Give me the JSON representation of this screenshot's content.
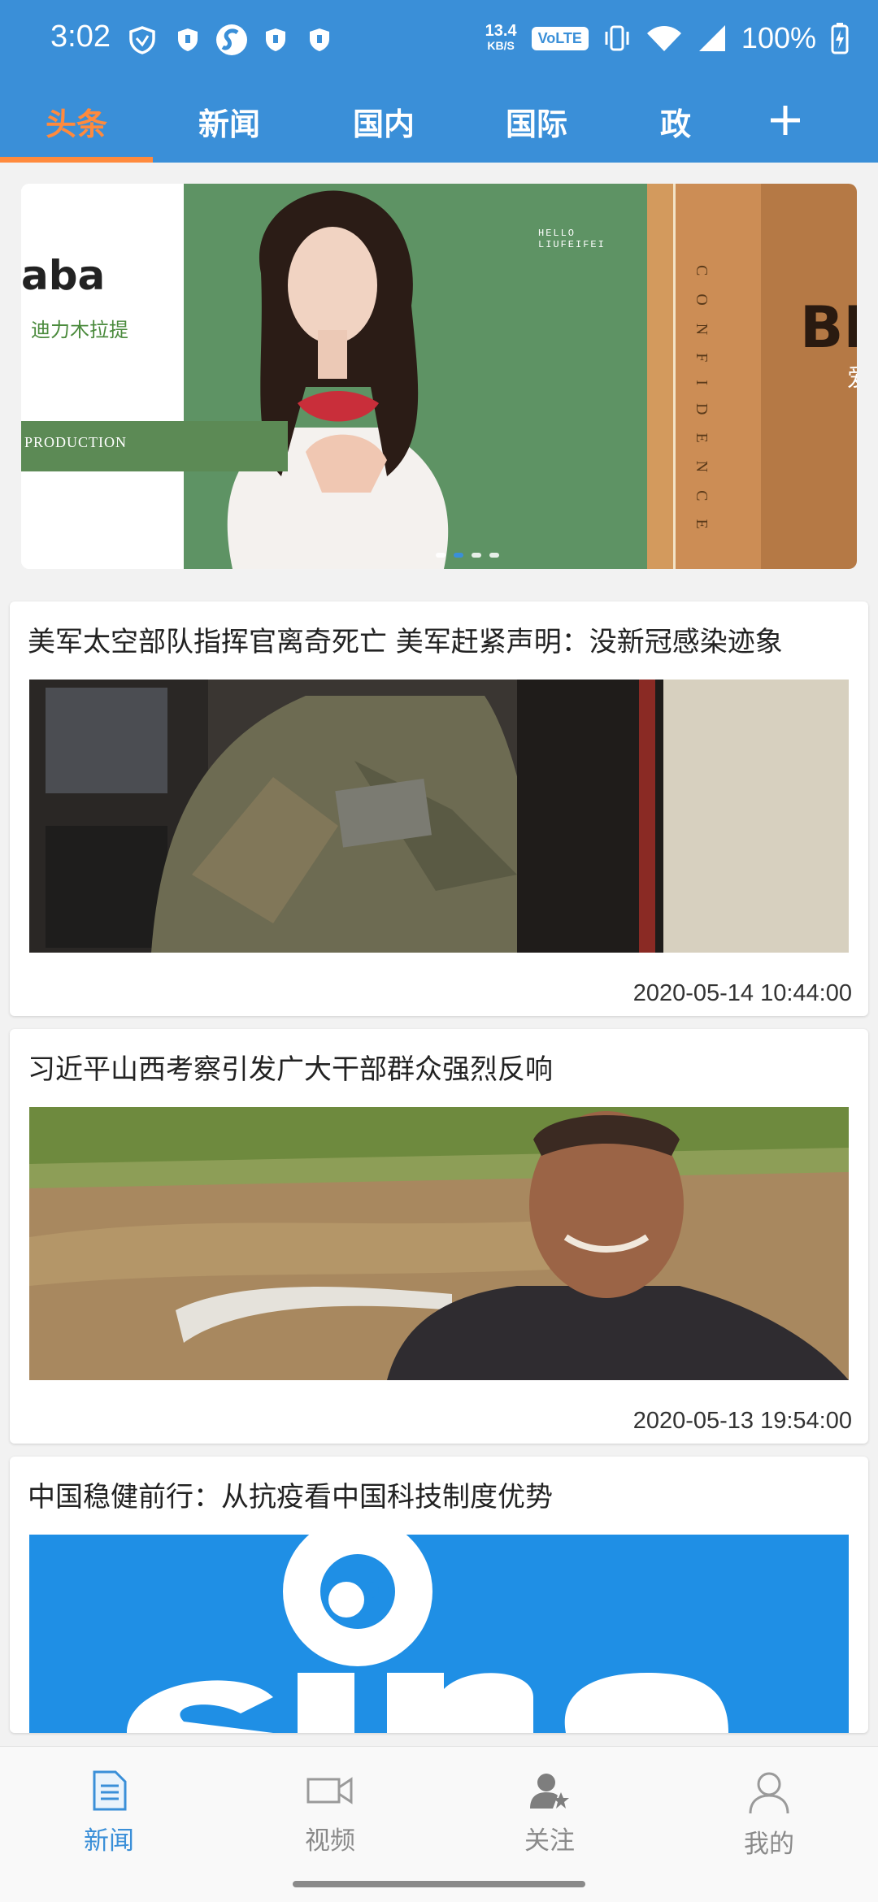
{
  "status_bar": {
    "time": "3:02",
    "net_speed_value": "13.4",
    "net_speed_unit": "KB/S",
    "volte": "VoLTE",
    "battery": "100%"
  },
  "tabs": [
    {
      "label": "头条",
      "active": true
    },
    {
      "label": "新闻",
      "active": false
    },
    {
      "label": "国内",
      "active": false
    },
    {
      "label": "国际",
      "active": false
    },
    {
      "label": "政",
      "active": false
    }
  ],
  "banner": {
    "left_big": "aba",
    "left_sub": "迪力木拉提",
    "left_bar": "PRODUCTION",
    "hello": "HELLO LIUFEIFEI",
    "confidence": "CONFIDENCE",
    "right_big": "BE",
    "right_sub": "爱",
    "indicator_count": 4,
    "indicator_active": 2
  },
  "articles": [
    {
      "title": "美军太空部队指挥官离奇死亡 美军赶紧声明：没新冠感染迹象",
      "date": "2020-05-14 10:44:00",
      "image": "soldier-photo"
    },
    {
      "title": "习近平山西考察引发广大干部群众强烈反响",
      "date": "2020-05-13 19:54:00",
      "image": "farmer-photo"
    },
    {
      "title": "中国稳健前行：从抗疫看中国科技制度优势",
      "date": "",
      "image": "sina-logo"
    }
  ],
  "bottom_nav": [
    {
      "label": "新闻",
      "icon": "news-icon",
      "active": true
    },
    {
      "label": "视频",
      "icon": "video-icon",
      "active": false
    },
    {
      "label": "关注",
      "icon": "follow-icon",
      "active": false
    },
    {
      "label": "我的",
      "icon": "profile-icon",
      "active": false
    }
  ],
  "colors": {
    "primary": "#3a8fd8",
    "tab_active": "#ff8a3d"
  }
}
